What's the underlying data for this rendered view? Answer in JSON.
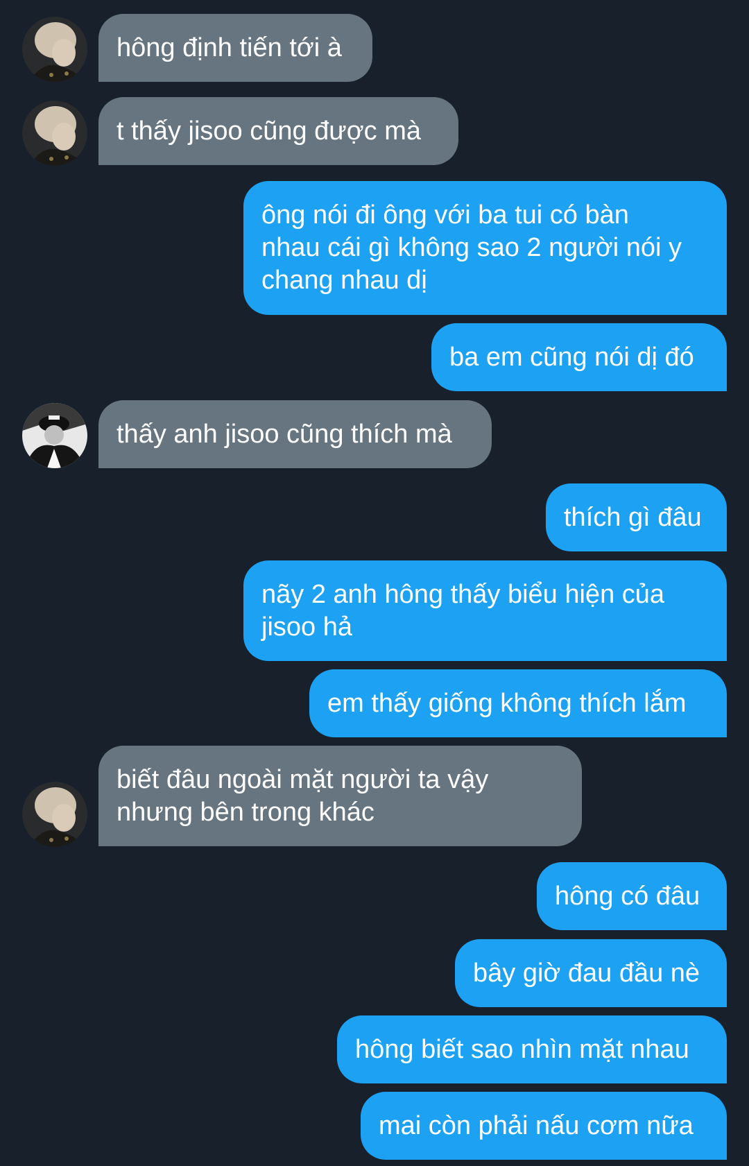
{
  "conversation": {
    "messages": [
      {
        "sender": "friend",
        "avatar": "blonde-avatar",
        "text": "hông định tiến tới à"
      },
      {
        "sender": "friend",
        "avatar": "blonde-avatar",
        "text": "t thấy jisoo cũng được mà"
      },
      {
        "sender": "me",
        "text": "ông nói đi ông với ba tui có bàn\nnhau cái gì không sao 2 người nói y\nchang nhau dị"
      },
      {
        "sender": "me",
        "text": "ba em cũng nói dị đó"
      },
      {
        "sender": "friend",
        "avatar": "cap-avatar",
        "text": "thấy anh jisoo cũng thích mà"
      },
      {
        "sender": "me",
        "text": "thích gì đâu"
      },
      {
        "sender": "me",
        "text": "nãy 2 anh hông thấy biểu hiện của\njisoo hả"
      },
      {
        "sender": "me",
        "text": "em thấy giống không thích lắm"
      },
      {
        "sender": "friend",
        "avatar": "blonde-avatar",
        "text": "biết đâu ngoài mặt người ta vậy\nnhưng bên trong khác"
      },
      {
        "sender": "me",
        "text": "hông có đâu"
      },
      {
        "sender": "me",
        "text": "bây giờ đau đầu nè"
      },
      {
        "sender": "me",
        "text": "hông biết sao nhìn mặt nhau"
      },
      {
        "sender": "me",
        "text": "mai còn phải nấu cơm nữa"
      }
    ]
  },
  "colors": {
    "background": "#17202b",
    "incoming_bubble": "#66757f",
    "outgoing_bubble": "#1da1f2",
    "text": "#ffffff"
  }
}
